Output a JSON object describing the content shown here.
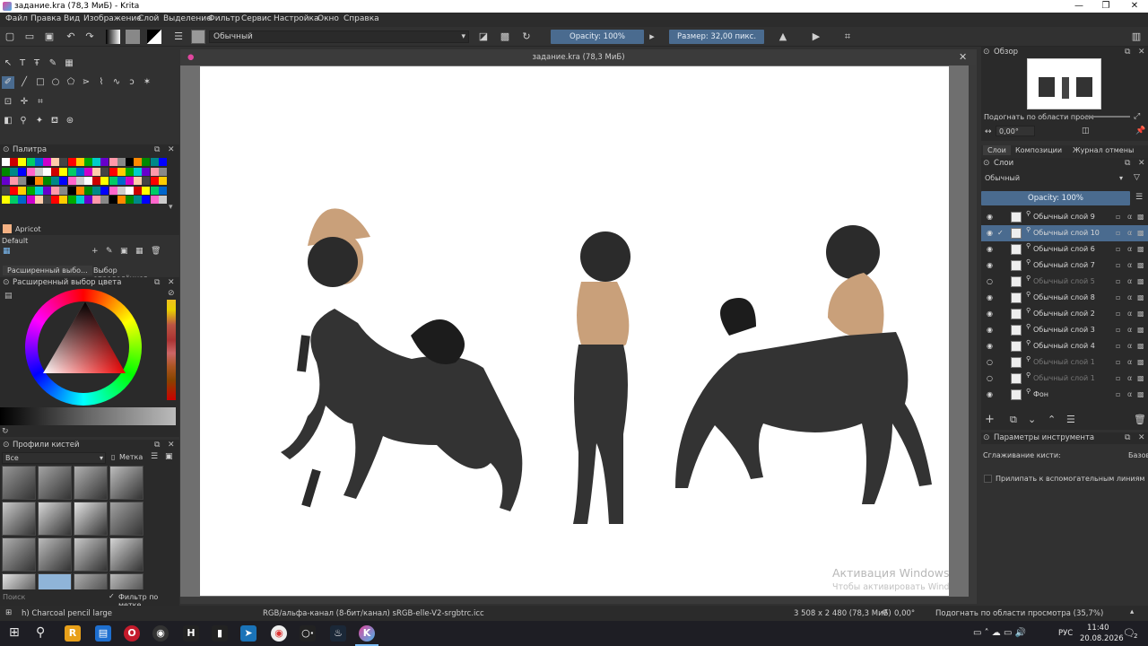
{
  "window": {
    "title": "задание.kra (78,3 МиБ) - Krita",
    "controls": [
      "—",
      "❐",
      "✕"
    ]
  },
  "menu": [
    "Файл",
    "Правка",
    "Вид",
    "Изображение",
    "Слой",
    "Выделение",
    "Фильтр",
    "Сервис",
    "Настройка",
    "Окно",
    "Справка"
  ],
  "toolbar": {
    "blend_mode": "Обычный",
    "opacity": "Opacity: 100%",
    "size": "Размер: 32,00 пикс."
  },
  "document": {
    "tab_title": "задание.kra (78,3 МиБ)",
    "watermark_title": "Активация Windows",
    "watermark_text": "Чтобы активировать Windows, перейдите в раздел \"Параметры\"."
  },
  "palette": {
    "title": "Палитра",
    "current_color_name": "Apricot",
    "current_color": "#f4b183",
    "set_name": "Default",
    "tabs": [
      "Расширенный выбо...",
      "Выбор определённог..."
    ]
  },
  "color_selector": {
    "title": "Расширенный выбор цвета"
  },
  "brush_presets": {
    "title": "Профили кистей",
    "filter_value": "Все",
    "tag_label": "Метка",
    "search_placeholder": "Поиск",
    "filter_by_tag": "Фильтр по метке"
  },
  "overview": {
    "title": "Обзор",
    "fit_label": "Подогнать по области просм",
    "angle": "0,00°"
  },
  "docker_tabs": [
    "Слои",
    "Композиции",
    "Журнал отмены"
  ],
  "layers": {
    "title": "Слои",
    "blend_mode": "Обычный",
    "opacity": "Opacity: 100%",
    "items": [
      {
        "name": "Обычный слой 9",
        "visible": true,
        "selected": false
      },
      {
        "name": "Обычный слой 10",
        "visible": true,
        "selected": true
      },
      {
        "name": "Обычный слой 6",
        "visible": true,
        "selected": false
      },
      {
        "name": "Обычный слой 7",
        "visible": true,
        "selected": false
      },
      {
        "name": "Обычный слой 5",
        "visible": false,
        "selected": false
      },
      {
        "name": "Обычный слой 8",
        "visible": true,
        "selected": false
      },
      {
        "name": "Обычный слой 2",
        "visible": true,
        "selected": false
      },
      {
        "name": "Обычный слой 3",
        "visible": true,
        "selected": false
      },
      {
        "name": "Обычный слой 4",
        "visible": true,
        "selected": false
      },
      {
        "name": "Обычный слой 1",
        "visible": false,
        "selected": false
      },
      {
        "name": "Обычный слой 1",
        "visible": false,
        "selected": false
      },
      {
        "name": "Фон",
        "visible": true,
        "selected": false
      }
    ]
  },
  "tool_options": {
    "title": "Параметры инструмента",
    "smoothing_label": "Сглаживание кисти:",
    "smoothing_value": "Базов",
    "snap_label": "Прилипать к вспомогательным линиям"
  },
  "status": {
    "brush": "h) Charcoal pencil large",
    "color_space": "RGB/альфа-канал (8-бит/канал)  sRGB-elle-V2-srgbtrc.icc",
    "dimensions": "3 508 x 2 480 (78,3 МиБ)",
    "rotation": "0,00°",
    "zoom": "Подогнать по области просмотра (35,7%)"
  },
  "taskbar": {
    "lang": "РУС",
    "time": "11:40",
    "date": "20.08.2026",
    "notifications": "2"
  },
  "colors": {
    "accent": "#4a6b8f",
    "panel": "#313131",
    "horse_body": "#2b2b2b",
    "skin": "#c9a07a"
  }
}
